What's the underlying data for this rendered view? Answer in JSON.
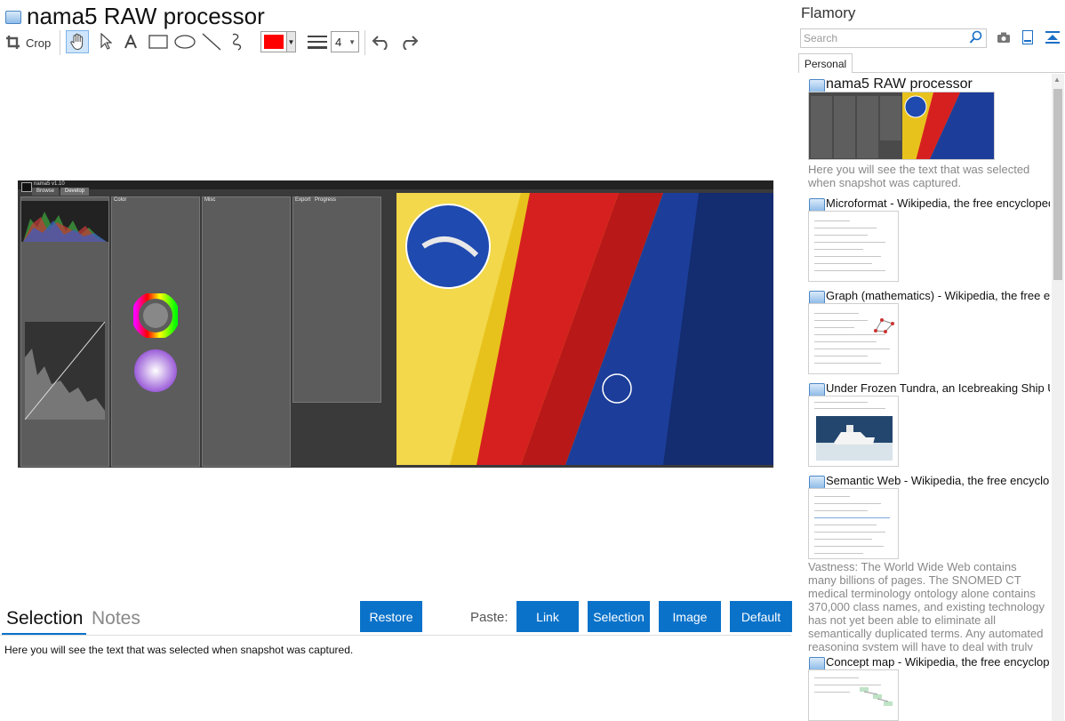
{
  "header": {
    "title": "nama5 RAW processor",
    "icon": "app-window-icon"
  },
  "toolbar": {
    "crop_label": "Crop",
    "line_width_value": "4",
    "color": "#ff0000",
    "tools": [
      "crop-icon",
      "hand-icon",
      "pointer-icon",
      "text-icon",
      "rectangle-icon",
      "ellipse-icon",
      "line-icon",
      "freehand-icon",
      "color-picker",
      "line-width-icon",
      "undo-icon",
      "redo-icon"
    ]
  },
  "screenshot": {
    "app_name": "nama5 v1.10",
    "tabs": [
      "Browse",
      "Develop"
    ],
    "panels": [
      "Color",
      "Misc",
      "Export",
      "Progress"
    ]
  },
  "bottom": {
    "tab_selection": "Selection",
    "tab_notes": "Notes",
    "restore_label": "Restore",
    "paste_label": "Paste:",
    "link_label": "Link",
    "selection_label": "Selection",
    "image_label": "Image",
    "default_label": "Default",
    "selected_text": "Here you will see the text that was selected when snapshot was captured."
  },
  "right_panel": {
    "title": "Flamory",
    "search_placeholder": "Search",
    "tab_personal": "Personal",
    "entries": [
      {
        "title": "nama5 RAW processor",
        "desc": "Here you will see the text that was selected when snapshot was captured."
      },
      {
        "title": "Microformat - Wikipedia, the free encyclopedia"
      },
      {
        "title": "Graph (mathematics) - Wikipedia, the free ency"
      },
      {
        "title": "Under Frozen Tundra, an Icebreaking Ship Unco"
      },
      {
        "title": "Semantic Web - Wikipedia, the free encycloped",
        "desc": "Vastness: The World Wide Web contains many billions of pages. The SNOMED CT medical terminology ontology alone contains 370,000 class names, and existing technology has not yet been able to eliminate all semantically duplicated terms. Any automated reasoning system will have to deal with truly huge inputs."
      },
      {
        "title": "Concept map - Wikipedia, the free encyclopedi"
      }
    ]
  },
  "colors": {
    "accent": "#0a72c9",
    "pen": "#ff0000"
  }
}
